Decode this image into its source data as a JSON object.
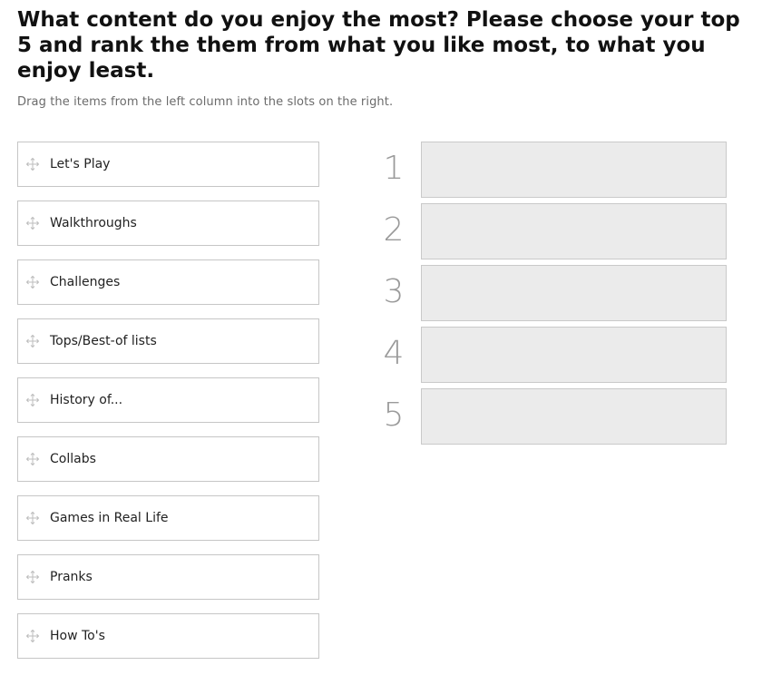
{
  "question": {
    "title": "What content do you enjoy the most? Please choose your top 5 and rank the them from what you like most, to what you enjoy least.",
    "instructions": "Drag the items from the left column into the slots on the right."
  },
  "items": [
    {
      "label": "Let's Play",
      "icon": "drag-move-icon"
    },
    {
      "label": "Walkthroughs",
      "icon": "drag-move-icon"
    },
    {
      "label": "Challenges",
      "icon": "drag-move-icon"
    },
    {
      "label": "Tops/Best-of lists",
      "icon": "drag-move-icon"
    },
    {
      "label": "History of...",
      "icon": "drag-move-icon"
    },
    {
      "label": "Collabs",
      "icon": "drag-move-icon"
    },
    {
      "label": "Games in Real Life",
      "icon": "drag-move-icon"
    },
    {
      "label": "Pranks",
      "icon": "drag-move-icon"
    },
    {
      "label": "How To's",
      "icon": "drag-move-icon"
    }
  ],
  "ranks": [
    {
      "number": "1",
      "value": ""
    },
    {
      "number": "2",
      "value": ""
    },
    {
      "number": "3",
      "value": ""
    },
    {
      "number": "4",
      "value": ""
    },
    {
      "number": "5",
      "value": ""
    }
  ],
  "colors": {
    "slot_background": "#ebebeb",
    "item_border": "#c6c6c6",
    "rank_number": "#9a9a9a",
    "instruction_text": "#6b6b6b"
  }
}
